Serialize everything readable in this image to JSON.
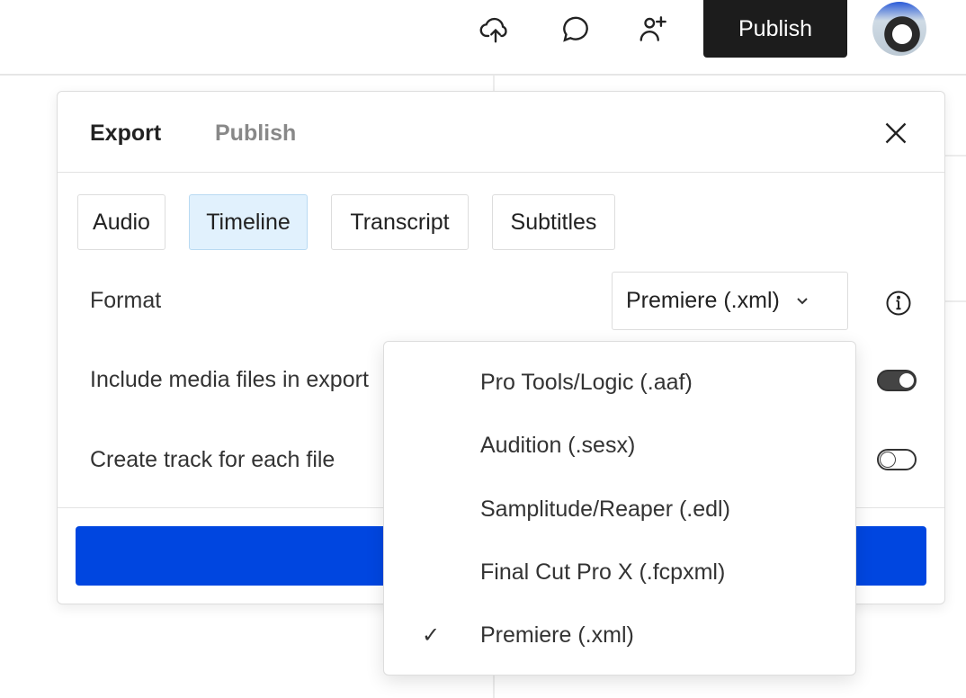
{
  "topbar": {
    "publish_label": "Publish",
    "icons": [
      "cloud-upload-icon",
      "comment-icon",
      "add-user-icon"
    ]
  },
  "dialog": {
    "tabs": [
      {
        "label": "Export",
        "active": true
      },
      {
        "label": "Publish",
        "active": false
      }
    ],
    "categories": [
      {
        "label": "Audio"
      },
      {
        "label": "Timeline",
        "active": true
      },
      {
        "label": "Transcript"
      },
      {
        "label": "Subtitles"
      }
    ],
    "format_label": "Format",
    "format_value": "Premiere (.xml)",
    "include_media_label": "Include media files in export",
    "include_media_on": true,
    "track_per_file_label": "Create track for each file",
    "track_per_file_on": false,
    "accent": "#0046e0"
  },
  "format_menu": {
    "options": [
      {
        "label": "Pro Tools/Logic (.aaf)"
      },
      {
        "label": "Audition (.sesx)"
      },
      {
        "label": "Samplitude/Reaper (.edl)"
      },
      {
        "label": "Final Cut Pro X (.fcpxml)"
      },
      {
        "label": "Premiere (.xml)",
        "selected": true,
        "check": "✓"
      }
    ]
  }
}
